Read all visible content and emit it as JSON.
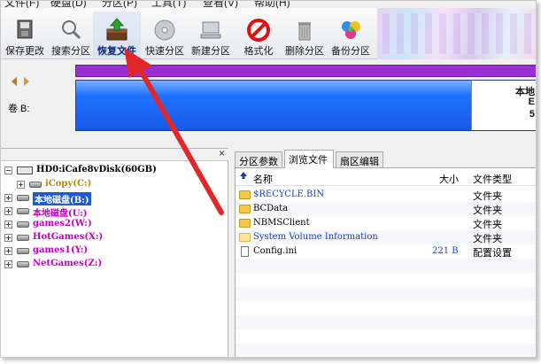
{
  "menubar": {
    "items": [
      "文件(F)",
      "硬盘(D)",
      "分区(P)",
      "工具(T)",
      "查看(V)",
      "帮助(H)"
    ]
  },
  "toolbar": {
    "buttons": [
      {
        "label": "保存更改",
        "icon": "save-disk-icon"
      },
      {
        "label": "搜索分区",
        "icon": "magnifier-icon"
      },
      {
        "label": "恢复文件",
        "icon": "recovery-box-icon"
      },
      {
        "label": "快速分区",
        "icon": "quick-partition-disc-icon"
      },
      {
        "label": "新建分区",
        "icon": "new-partition-computer-icon"
      },
      {
        "label": "格式化",
        "icon": "format-forbid-icon"
      },
      {
        "label": "删除分区",
        "icon": "trash-can-icon"
      },
      {
        "label": "备份分区",
        "icon": "backup-colorful-icon"
      }
    ]
  },
  "disk_view": {
    "volume_label": "卷 B:",
    "right_segment_title": "本地",
    "right_segment_line2": "E",
    "right_segment_line3": "5",
    "colors": {
      "top_bar": "#9a2fd0",
      "partition": "#1e72ff"
    }
  },
  "tree": {
    "disk": "HD0:iCafe8vDisk(60GB)",
    "items": [
      {
        "label": "iCopy(C:)",
        "color": "#b8860b",
        "selected": false
      },
      {
        "label": "本地磁盘(B:)",
        "color": "#ffffff",
        "selected": true
      },
      {
        "label": "本地磁盘(U:)",
        "color": "#c000c0",
        "selected": false
      },
      {
        "label": "games2(W:)",
        "color": "#c000c0",
        "selected": false
      },
      {
        "label": "HotGames(X:)",
        "color": "#c000c0",
        "selected": false
      },
      {
        "label": "games1(Y:)",
        "color": "#c000c0",
        "selected": false
      },
      {
        "label": "NetGames(Z:)",
        "color": "#c000c0",
        "selected": false
      }
    ]
  },
  "tabs": [
    "分区参数",
    "浏览文件",
    "扇区编辑"
  ],
  "filelist": {
    "columns": {
      "up": "名称",
      "size": "大小",
      "type": "文件类型"
    },
    "rows": [
      {
        "name": "$RECYCLE.BIN",
        "size": "",
        "type": "文件夹",
        "kind": "folder",
        "color": "#1e40c8"
      },
      {
        "name": "BCData",
        "size": "",
        "type": "文件夹",
        "kind": "folder",
        "color": "#000000"
      },
      {
        "name": "NBMSClient",
        "size": "",
        "type": "文件夹",
        "kind": "folder",
        "color": "#000000"
      },
      {
        "name": "System Volume Information",
        "size": "",
        "type": "文件夹",
        "kind": "folder-light",
        "color": "#1e40c8"
      },
      {
        "name": "Config.ini",
        "size": "221 B",
        "type": "配置设置",
        "kind": "file",
        "color": "#000000"
      }
    ]
  },
  "annotation": {
    "arrow_color": "#e02020"
  }
}
